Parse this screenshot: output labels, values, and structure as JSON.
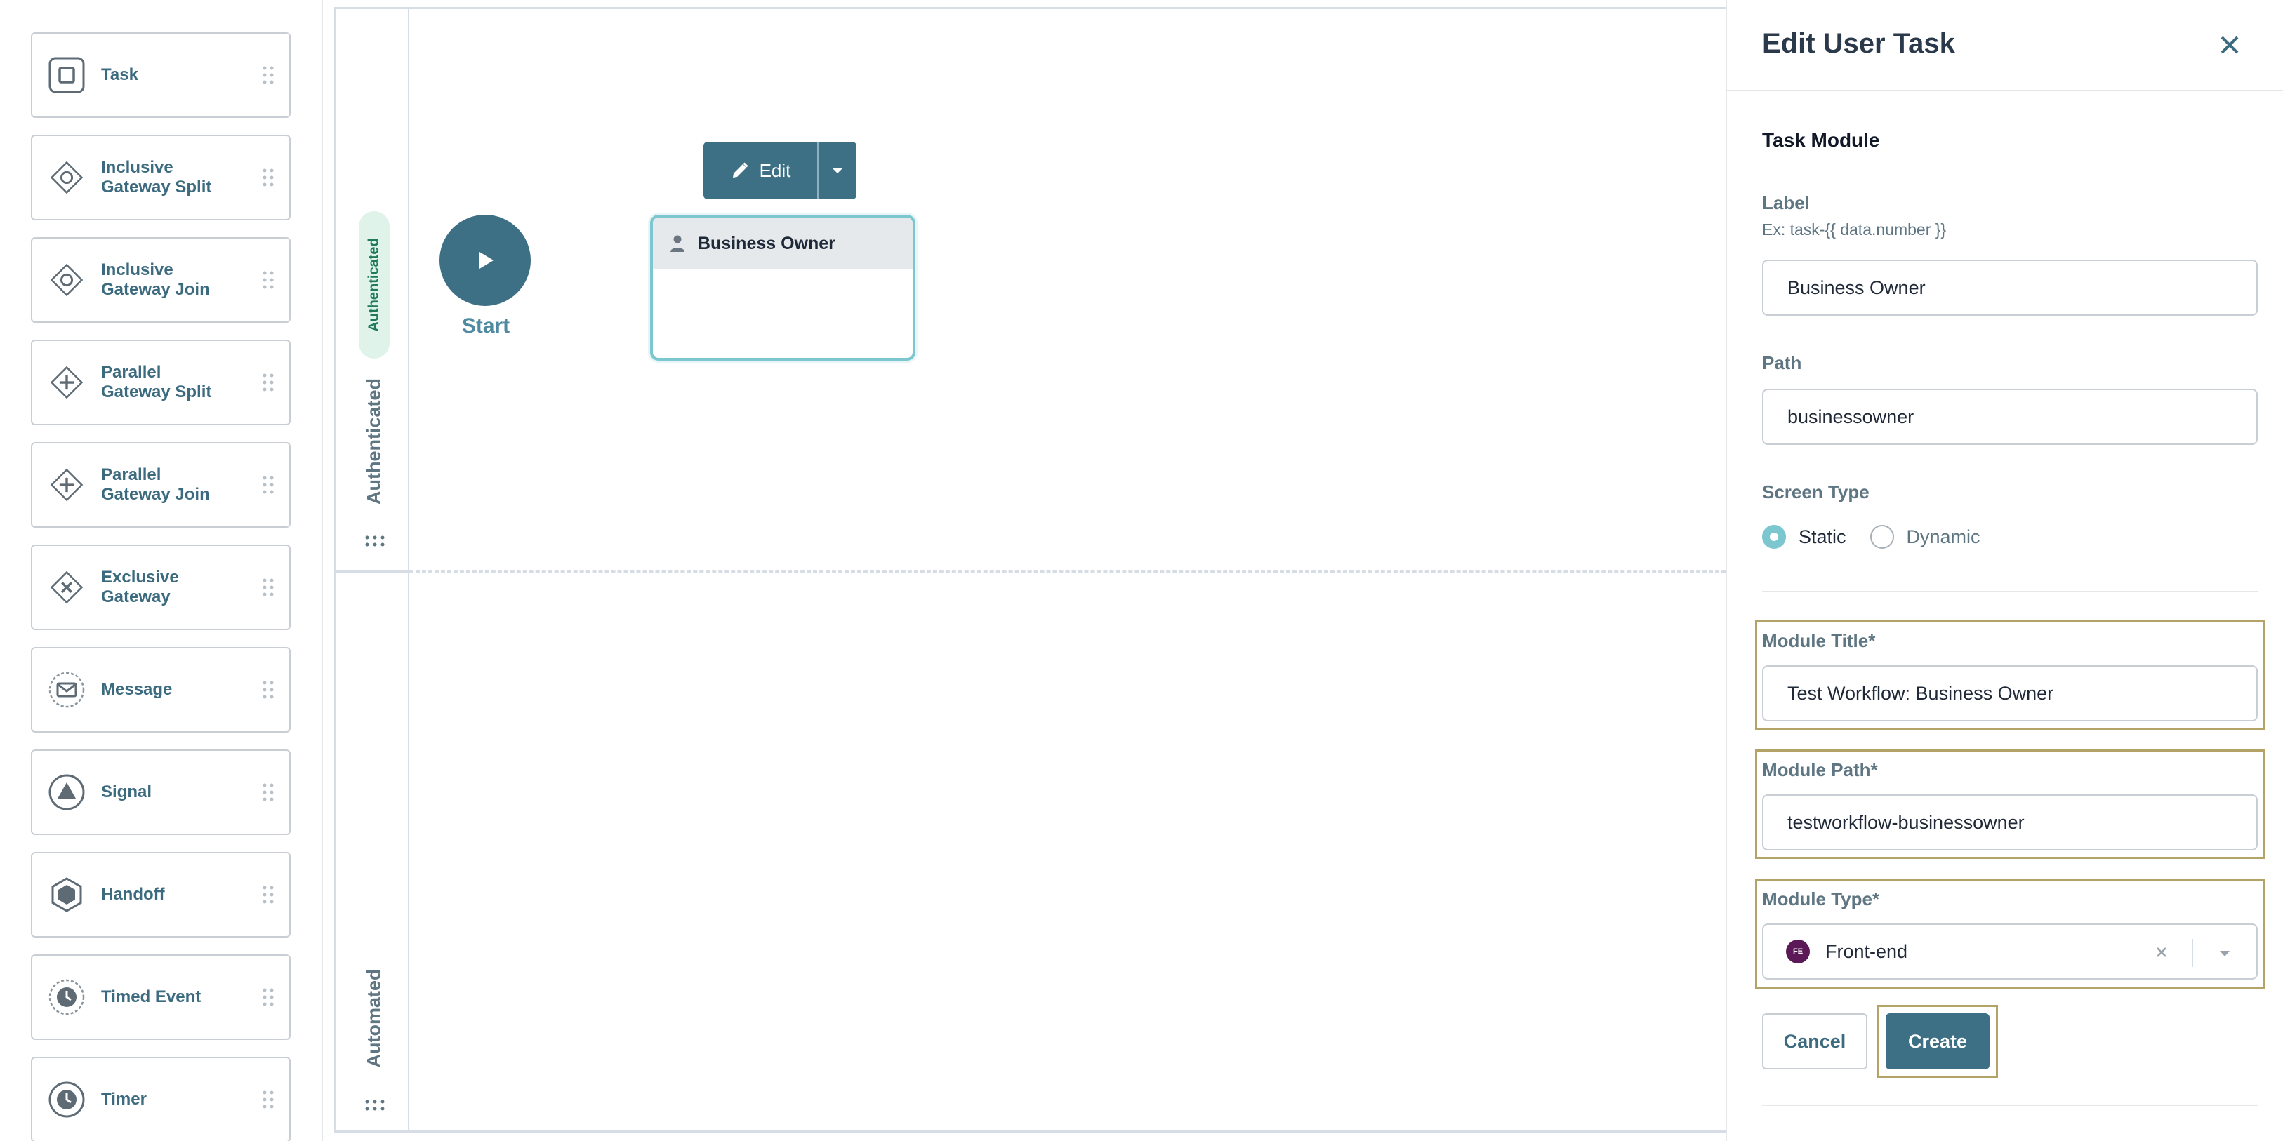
{
  "palette": {
    "items": [
      {
        "label": "Task",
        "icon": "task-icon"
      },
      {
        "label": "Inclusive\nGateway Split",
        "icon": "inclusive-gateway-icon"
      },
      {
        "label": "Inclusive\nGateway Join",
        "icon": "inclusive-gateway-icon"
      },
      {
        "label": "Parallel\nGateway Split",
        "icon": "parallel-gateway-icon"
      },
      {
        "label": "Parallel\nGateway Join",
        "icon": "parallel-gateway-icon"
      },
      {
        "label": "Exclusive\nGateway",
        "icon": "exclusive-gateway-icon"
      },
      {
        "label": "Message",
        "icon": "envelope-icon"
      },
      {
        "label": "Signal",
        "icon": "signal-triangle-icon"
      },
      {
        "label": "Handoff",
        "icon": "hexagon-icon"
      },
      {
        "label": "Timed Event",
        "icon": "clock-icon"
      },
      {
        "label": "Timer",
        "icon": "clock-icon"
      }
    ]
  },
  "canvas": {
    "lane_pill": "Authenticated",
    "lane1_label": "Authenticated",
    "lane2_label": "Automated",
    "start_label": "Start",
    "edit_label": "Edit",
    "task_node_title": "Business Owner"
  },
  "panel": {
    "title": "Edit User Task",
    "section": "Task Module",
    "label_field": {
      "label": "Label",
      "hint": "Ex: task-{{ data.number }}",
      "value": "Business Owner"
    },
    "path_field": {
      "label": "Path",
      "value": "businessowner"
    },
    "screen_type": {
      "label": "Screen Type",
      "options": [
        "Static",
        "Dynamic"
      ],
      "selected": "Static"
    },
    "module_title": {
      "label": "Module Title*",
      "value": "Test Workflow: Business Owner"
    },
    "module_path": {
      "label": "Module Path*",
      "value": "testworkflow-businessowner"
    },
    "module_type": {
      "label": "Module Type*",
      "badge": "FE",
      "value": "Front-end"
    },
    "cancel_label": "Cancel",
    "create_label": "Create"
  },
  "colors": {
    "accent": "#3d7085",
    "highlight": "#b3a366",
    "selection": "#7cc7cf"
  }
}
